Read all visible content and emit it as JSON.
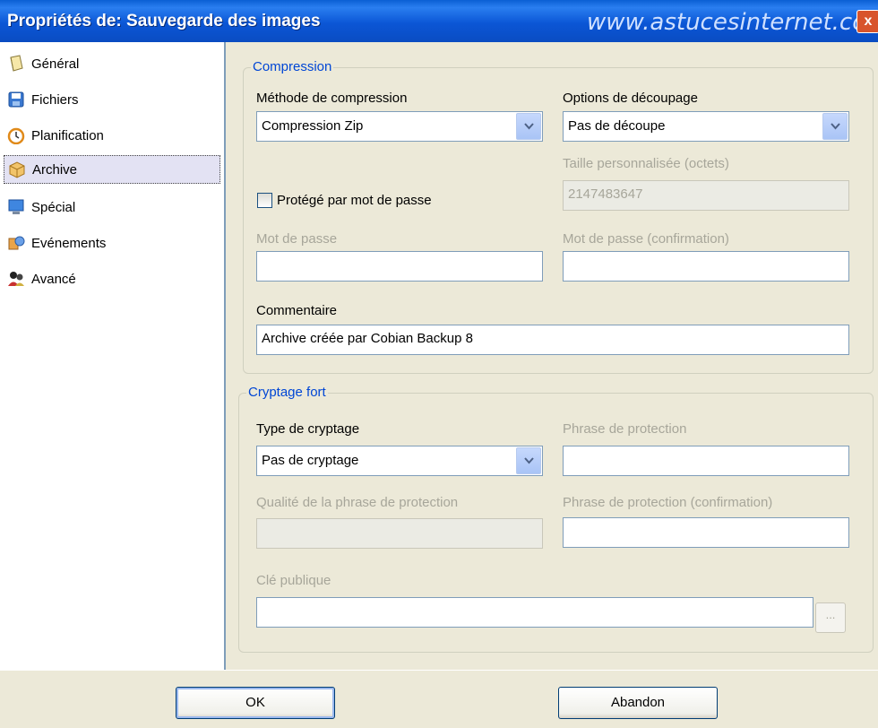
{
  "window": {
    "title": "Propriétés de: Sauvegarde des images",
    "watermark": "www.astucesinternet.com",
    "close_label": "x"
  },
  "sidebar": {
    "items": [
      {
        "label": "Général",
        "icon": "book-icon"
      },
      {
        "label": "Fichiers",
        "icon": "floppy-icon"
      },
      {
        "label": "Planification",
        "icon": "clock-icon"
      },
      {
        "label": "Archive",
        "icon": "package-icon",
        "selected": true
      },
      {
        "label": "Spécial",
        "icon": "monitor-icon"
      },
      {
        "label": "Evénements",
        "icon": "events-icon"
      },
      {
        "label": "Avancé",
        "icon": "users-icon"
      }
    ]
  },
  "compression": {
    "legend": "Compression",
    "method_label": "Méthode de compression",
    "method_value": "Compression Zip",
    "split_label": "Options de découpage",
    "split_value": "Pas de découpe",
    "custom_size_label": "Taille personnalisée (octets)",
    "custom_size_value": "2147483647",
    "password_protected_label": "Protégé par mot de passe",
    "password_protected_checked": false,
    "password_label": "Mot de passe",
    "password_value": "",
    "password_confirm_label": "Mot de passe (confirmation)",
    "password_confirm_value": "",
    "comment_label": "Commentaire",
    "comment_value": "Archive créée par Cobian Backup 8"
  },
  "encryption": {
    "legend": "Cryptage fort",
    "type_label": "Type de cryptage",
    "type_value": "Pas de cryptage",
    "passphrase_label": "Phrase de protection",
    "passphrase_value": "",
    "quality_label": "Qualité de la phrase de protection",
    "passphrase_confirm_label": "Phrase de protection (confirmation)",
    "passphrase_confirm_value": "",
    "public_key_label": "Clé publique",
    "public_key_value": "",
    "browse_label": "..."
  },
  "footer": {
    "ok_label": "OK",
    "cancel_label": "Abandon"
  },
  "colors": {
    "titlebar": "#0b56d6",
    "legend": "#0046d5",
    "disabled_text": "#a7a69a",
    "dialog_bg": "#ece9d8"
  }
}
